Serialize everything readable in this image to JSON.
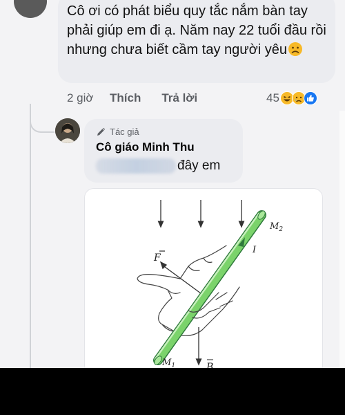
{
  "comment": {
    "text": "Cô ơi có phát biểu quy tắc nắm bàn tay phải giúp em đi ạ. Năm nay 22 tuổi đầu rồi nhưng chưa biết cầm tay người yêu",
    "emoji": "confused-face-emoji",
    "time": "2 giờ",
    "like_label": "Thích",
    "reply_label": "Trả lời",
    "reaction_count": "45",
    "reaction_icons": [
      "haha-icon",
      "sad-icon",
      "like-icon"
    ]
  },
  "reply": {
    "author_badge": "Tác giả",
    "author_name": "Cô giáo Minh Thu",
    "text": "đây em",
    "figure_labels": {
      "m2": "M",
      "m2_sub": "2",
      "m1": "M",
      "m1_sub": "1",
      "current": "I",
      "force": "F",
      "field": "B"
    }
  },
  "colors": {
    "bubble": "#ebecf0",
    "meta_text": "#5b5e63",
    "rod": "#7bd36b",
    "like_blue": "#1877f2",
    "emoji_yellow": "#f7b928"
  }
}
